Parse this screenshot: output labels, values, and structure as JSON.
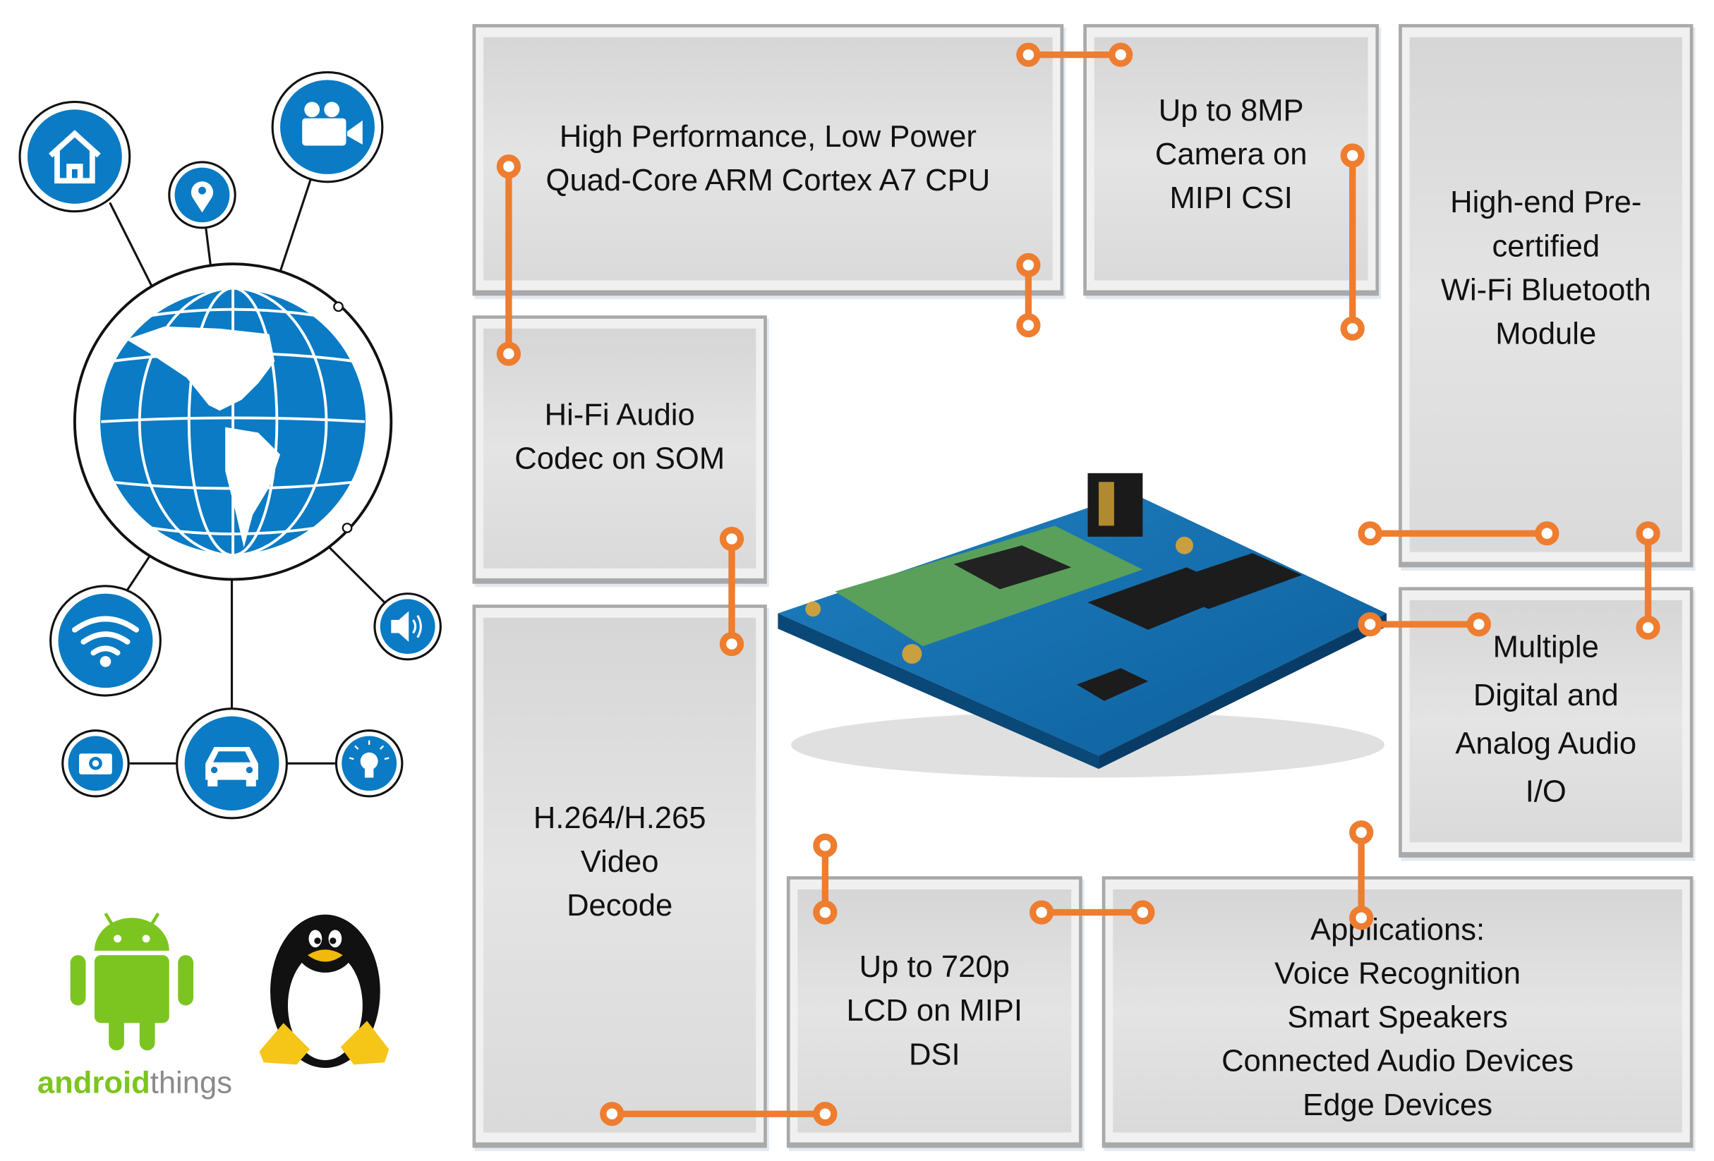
{
  "colors": {
    "accent": "#ee7d2f",
    "icon_blue": "#0a7bc4",
    "box_fill": "#dedede",
    "android_green": "#7cc520"
  },
  "boxes": {
    "cpu": [
      "High Performance, Low Power",
      "Quad-Core ARM Cortex A7 CPU"
    ],
    "camera": [
      "Up to 8MP",
      "Camera on",
      "MIPI CSI"
    ],
    "wifi": [
      "High-end Pre-",
      "certified",
      "Wi-Fi Bluetooth",
      "Module"
    ],
    "audio_codec": [
      "Hi-Fi Audio",
      "Codec on SOM"
    ],
    "video": [
      "H.264/H.265",
      "Video",
      "Decode"
    ],
    "audio_io": [
      "Multiple",
      "Digital and",
      "Analog Audio",
      "I/O"
    ],
    "lcd": [
      "Up to 720p",
      "LCD on MIPI",
      "DSI"
    ],
    "applications": [
      "Applications:",
      "Voice Recognition",
      "Smart Speakers",
      "Connected Audio Devices",
      "Edge Devices"
    ]
  },
  "logos": {
    "android_part1": "android",
    "android_part2": "things"
  },
  "icons": [
    "home-icon",
    "location-pin-icon",
    "video-camera-icon",
    "globe-icon",
    "wifi-icon",
    "speaker-icon",
    "camera-icon",
    "car-icon",
    "lightbulb-icon",
    "android-logo",
    "linux-tux-logo"
  ]
}
